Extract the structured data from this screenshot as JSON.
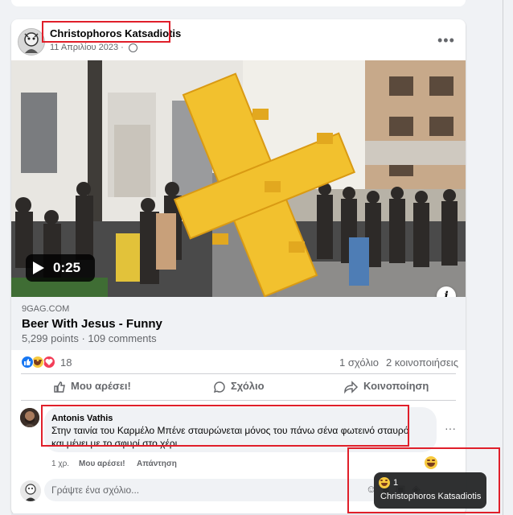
{
  "post": {
    "author": "Christophoros Katsadiotis",
    "date": "11 Απριλίου 2023",
    "video_duration": "0:25"
  },
  "link": {
    "domain": "9GAG.COM",
    "title": "Beer With Jesus - Funny",
    "subtitle": "5,299 points · 109 comments"
  },
  "stats": {
    "reaction_count": "18",
    "comments": "1 σχόλιο",
    "shares": "2 κοινοποιήσεις"
  },
  "actions": {
    "like": "Μου αρέσει!",
    "comment": "Σχόλιο",
    "share": "Κοινοποίηση"
  },
  "comment": {
    "author": "Antonis Vathis",
    "text": "Στην ταινία του Καρμέλο Μπένε σταυρώνεται μόνος του πάνω σένα φωτεινό σταυρό και μένει με το σφυρί στο χέρι",
    "age": "1 χρ.",
    "like": "Μου αρέσει!",
    "reply": "Απάντηση"
  },
  "composer": {
    "placeholder": "Γράψτε ένα σχόλιο..."
  },
  "tooltip": {
    "count": "1",
    "name": "Christophoros Katsadiotis"
  },
  "colors": {
    "like_blue": "#1877f2",
    "love_red": "#f33e58",
    "haha_yellow": "#f7c93e",
    "highlight_red": "#e01f2a"
  }
}
